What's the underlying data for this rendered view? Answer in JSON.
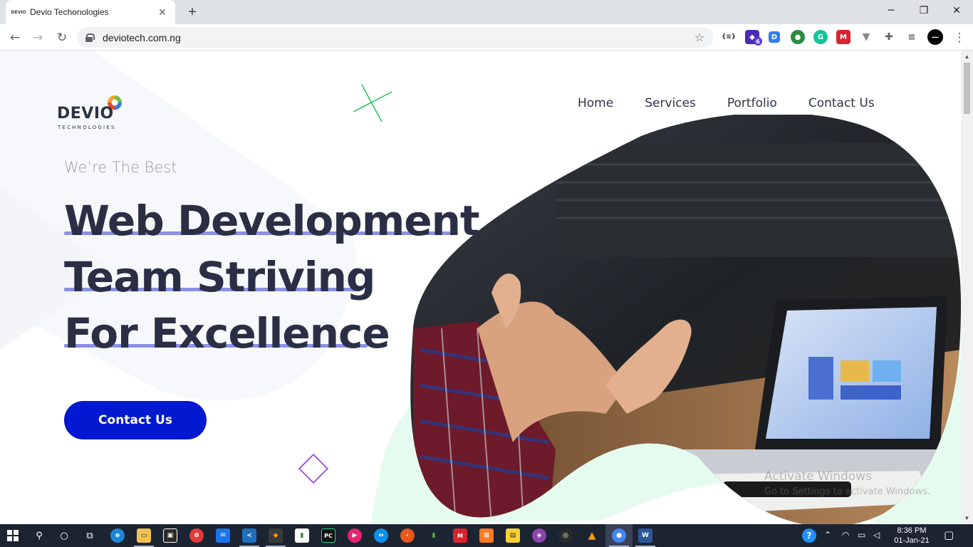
{
  "browser": {
    "tab_title": "Devio Techonologies",
    "tab_favicon": "DEVIO",
    "url": "deviotech.com.ng",
    "window_controls": [
      "minimize-icon",
      "restore-icon",
      "close-icon"
    ],
    "extensions": [
      "json-viewer",
      "stack-badge",
      "dashlane-d",
      "globe",
      "grammarly-g",
      "mendeley",
      "v-shield",
      "puzzle-extensions",
      "reading-list",
      "profile-avatar"
    ],
    "extension_badge": "6"
  },
  "site": {
    "logo_text": "DEVIO",
    "logo_subtext": "TECHNOLOGIES",
    "nav": [
      {
        "label": "Home"
      },
      {
        "label": "Services"
      },
      {
        "label": "Portfolio"
      },
      {
        "label": "Contact Us"
      }
    ],
    "tagline": "We’re The Best",
    "headline": [
      "Web Development",
      "Team Striving",
      "For Excellence"
    ],
    "cta_label": "Contact Us",
    "watermark_line1": "Activate Windows",
    "watermark_line2": "Go to Settings to activate Windows.",
    "colors": {
      "accent": "#0218d1",
      "heading": "#2a2f45",
      "underline": "#8b90e6",
      "mint": "#e6fbef",
      "cross": "#22c55e",
      "diamond": "#9b4dea",
      "ring": "#f5c542"
    }
  },
  "taskbar": {
    "time": "8:36 PM",
    "date": "01-Jan-21",
    "apps": [
      "edge",
      "file-explorer",
      "store",
      "app-red",
      "mail",
      "vscode",
      "git",
      "notepad",
      "pycharm",
      "media",
      "teamviewer",
      "app-orange",
      "mongodb",
      "app-m",
      "xampp",
      "sticky-notes",
      "app-gem",
      "obs",
      "vlc",
      "chrome",
      "word"
    ]
  }
}
